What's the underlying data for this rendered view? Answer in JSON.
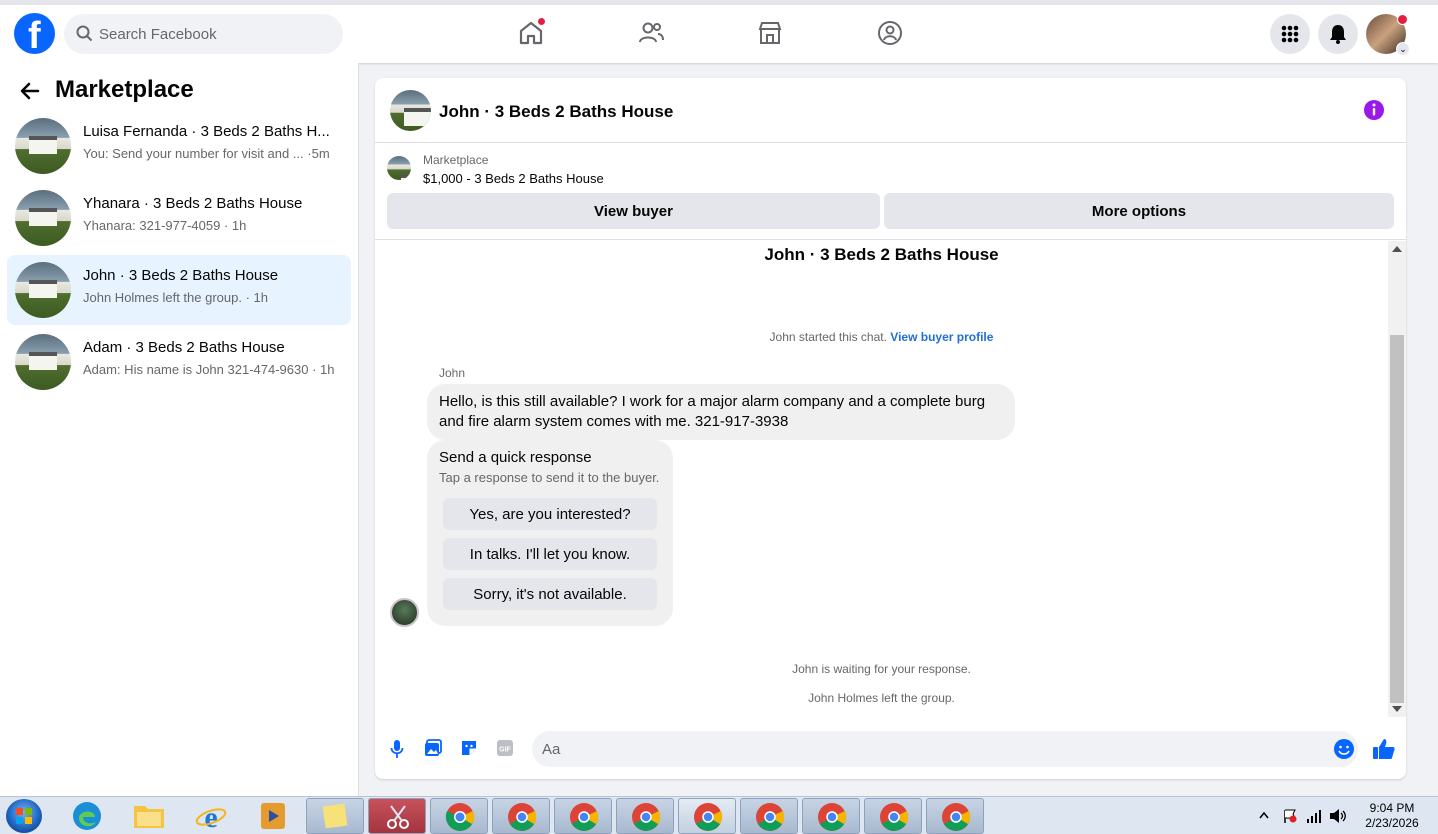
{
  "topbar": {
    "search_placeholder": "Search Facebook",
    "brand_color": "#0866ff",
    "notification_dot_color": "#e41e3f"
  },
  "sidebar": {
    "title": "Marketplace",
    "conversations": [
      {
        "name": "Luisa Fernanda · 3 Beds 2 Baths H...",
        "preview": "You: Send your number for visit and ...",
        "time": "·5m",
        "active": false
      },
      {
        "name": "Yhanara · 3 Beds 2 Baths House",
        "preview": "Yhanara: 321-977-4059 · 1h",
        "time": "",
        "active": false
      },
      {
        "name": "John · 3 Beds 2 Baths House",
        "preview": "John Holmes left the group. · 1h",
        "time": "",
        "active": true
      },
      {
        "name": "Adam · 3 Beds 2 Baths House",
        "preview": "Adam: His name is John 321-474-9630 · 1h",
        "time": "",
        "active": false
      }
    ]
  },
  "chat": {
    "header_title": "John · 3 Beds 2 Baths House",
    "marketplace_label": "Marketplace",
    "listing": "$1,000 - 3 Beds 2 Baths House",
    "view_buyer_label": "View buyer",
    "more_options_label": "More options",
    "body_title": "John · 3 Beds 2 Baths House",
    "started_text": "John started this chat.",
    "view_profile_link": "View buyer profile",
    "sender_name": "John",
    "message": "Hello, is this still available? I work for a major alarm company and a complete burg and fire alarm system comes with me. 321-917-3938",
    "quick_title": "Send a quick response",
    "quick_sub": "Tap a response to send it to the buyer.",
    "quick_replies": [
      "Yes, are you interested?",
      "In talks. I'll let you know.",
      "Sorry, it's not available."
    ],
    "waiting_text": "John is waiting for your response.",
    "left_text": "John Holmes left the group.",
    "composer_placeholder": "Aa",
    "accent_color": "#0866ff"
  },
  "taskbar": {
    "time": "9:04 PM",
    "date": "2/23/2026"
  }
}
